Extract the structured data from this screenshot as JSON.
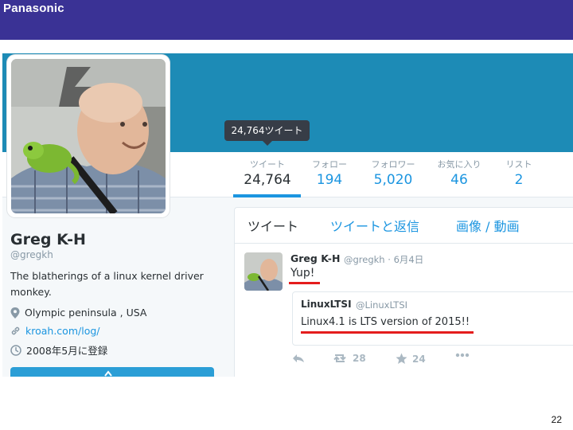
{
  "slide": {
    "brand": "Panasonic",
    "page_number": "22"
  },
  "tooltip": {
    "text": "24,764ツイート"
  },
  "stats": [
    {
      "label": "ツイート",
      "value": "24,764"
    },
    {
      "label": "フォロー",
      "value": "194"
    },
    {
      "label": "フォロワー",
      "value": "5,020"
    },
    {
      "label": "お気に入り",
      "value": "46"
    },
    {
      "label": "リスト",
      "value": "2"
    }
  ],
  "profile": {
    "name": "Greg K-H",
    "handle": "@gregkh",
    "bio": "The blatherings of a linux kernel driver monkey.",
    "location": "Olympic peninsula , USA",
    "website": "kroah.com/log/",
    "joined": "2008年5月に登録"
  },
  "tabs": [
    "ツイート",
    "ツイートと返信",
    "画像 / 動画"
  ],
  "tweet": {
    "name": "Greg K-H",
    "meta": "@gregkh · 6月4日",
    "text": "Yup!",
    "quote": {
      "name": "LinuxLTSI",
      "handle": "@LinuxLTSI",
      "text": "Linux4.1 is LTS version of 2015!!"
    },
    "actions": {
      "retweets": "28",
      "favorites": "24"
    }
  },
  "colors": {
    "header": "#3a3295",
    "banner": "#1d8bb6",
    "accent": "#1b95e0",
    "highlight": "#e41d1d"
  },
  "icons": [
    "reply-icon",
    "retweet-icon",
    "star-icon",
    "more-icon",
    "location-pin-icon",
    "link-icon",
    "clock-icon"
  ]
}
